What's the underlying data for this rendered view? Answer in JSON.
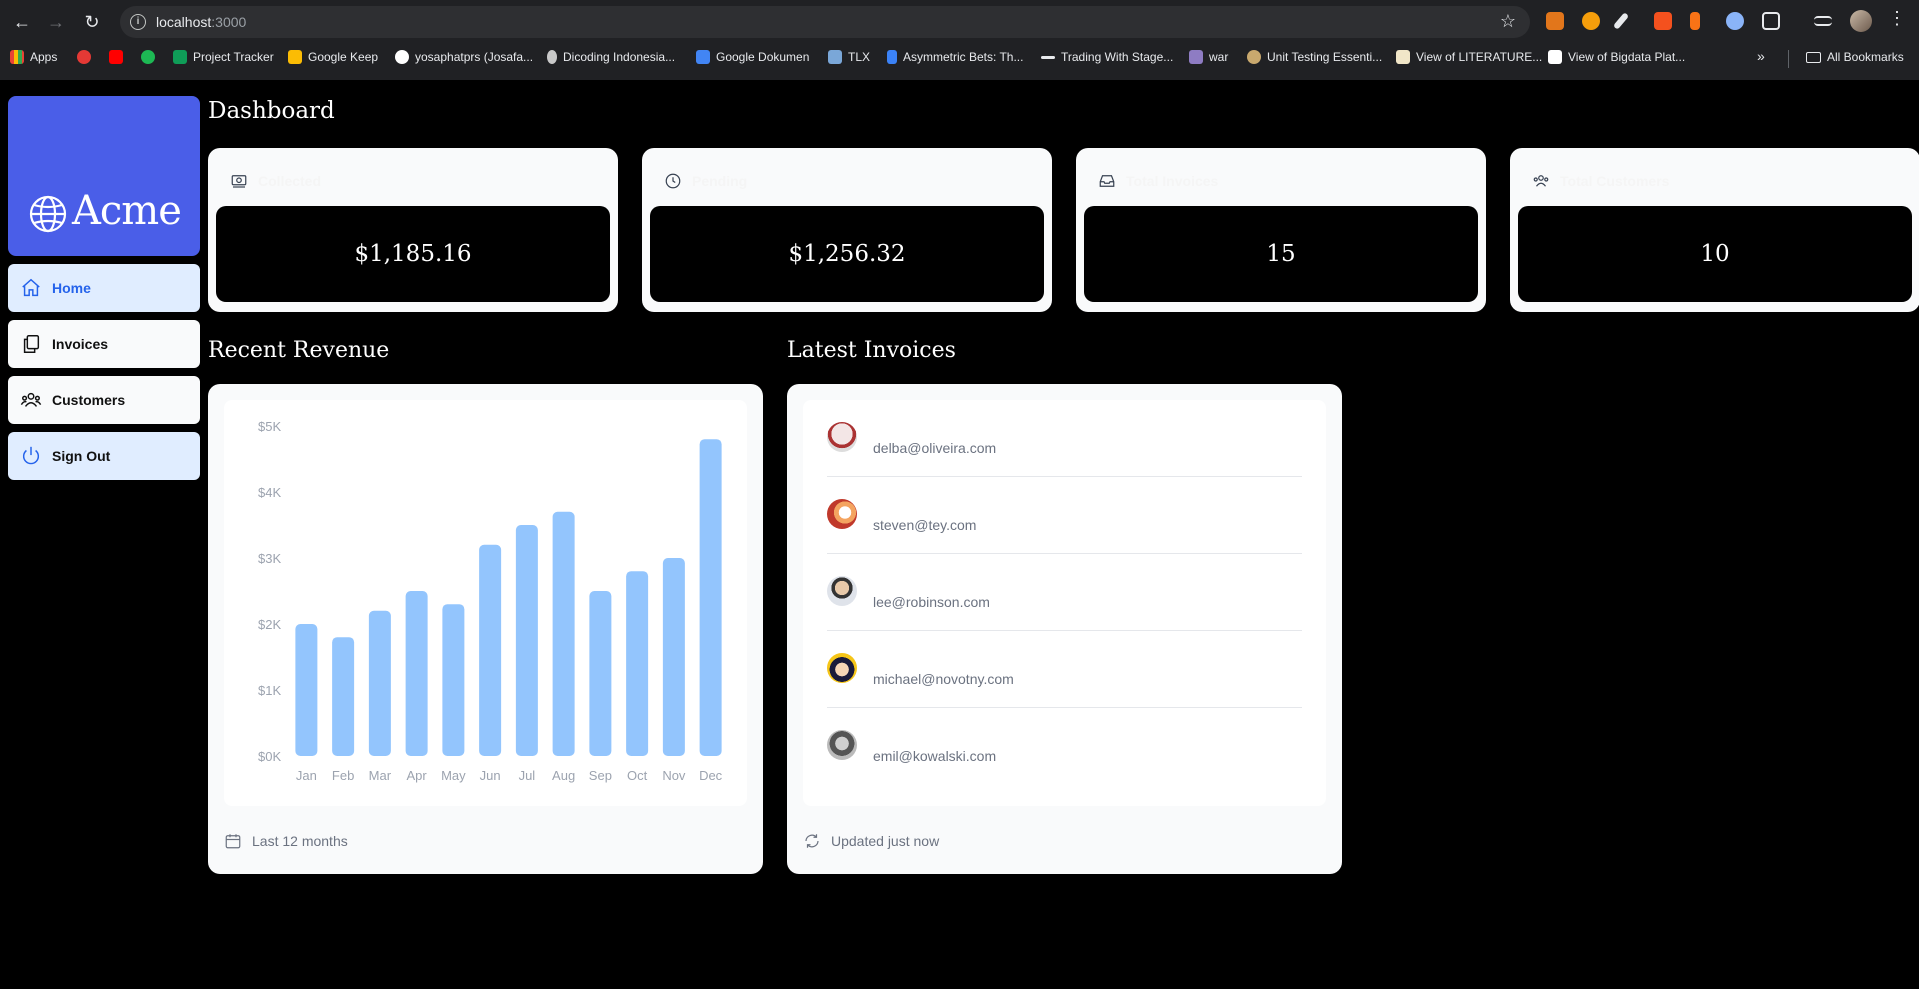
{
  "browser": {
    "url_host": "localhost",
    "url_port": ":3000",
    "bookmarks": [
      {
        "label": "Apps",
        "color": "#e8eaed"
      },
      {
        "label": "",
        "color": "#e53935"
      },
      {
        "label": "",
        "color": "#ff0000"
      },
      {
        "label": "",
        "color": "#1db954"
      },
      {
        "label": "Project Tracker",
        "color": "#0f9d58"
      },
      {
        "label": "Google Keep",
        "color": "#fbbc04"
      },
      {
        "label": "yosaphatprs (Josafa...",
        "color": "#ffffff"
      },
      {
        "label": "Dicoding Indonesia...",
        "color": "#c9c9c9"
      },
      {
        "label": "Google Dokumen",
        "color": "#4285f4"
      },
      {
        "label": "TLX",
        "color": "#7aa7d8"
      },
      {
        "label": "Asymmetric Bets: Th...",
        "color": "#3b82f6"
      },
      {
        "label": "Trading With Stage...",
        "color": "#e8eaed"
      },
      {
        "label": "war",
        "color": "#8e7cc3"
      },
      {
        "label": "Unit Testing Essenti...",
        "color": "#c9a96e"
      },
      {
        "label": "View of LITERATURE...",
        "color": "#f1e6c8"
      },
      {
        "label": "View of Bigdata Plat...",
        "color": "#ffffff"
      }
    ],
    "all_bookmarks": "All Bookmarks"
  },
  "sidebar": {
    "logo_text": "Acme",
    "items": [
      {
        "label": "Home",
        "icon": "home-icon"
      },
      {
        "label": "Invoices",
        "icon": "document-duplicate-icon"
      },
      {
        "label": "Customers",
        "icon": "user-group-icon"
      },
      {
        "label": "Sign Out",
        "icon": "power-icon"
      }
    ]
  },
  "dashboard": {
    "title": "Dashboard",
    "cards": [
      {
        "label": "Collected",
        "value": "$1,185.16",
        "icon": "banknotes-icon"
      },
      {
        "label": "Pending",
        "value": "$1,256.32",
        "icon": "clock-icon"
      },
      {
        "label": "Total Invoices",
        "value": "15",
        "icon": "inbox-icon"
      },
      {
        "label": "Total Customers",
        "value": "10",
        "icon": "user-group-icon"
      }
    ]
  },
  "revenue": {
    "title": "Recent Revenue",
    "footer": "Last 12 months"
  },
  "chart_data": {
    "type": "bar",
    "categories": [
      "Jan",
      "Feb",
      "Mar",
      "Apr",
      "May",
      "Jun",
      "Jul",
      "Aug",
      "Sep",
      "Oct",
      "Nov",
      "Dec"
    ],
    "values": [
      2000,
      1800,
      2200,
      2500,
      2300,
      3200,
      3500,
      3700,
      2500,
      2800,
      3000,
      4800
    ],
    "y_ticks": [
      "$0K",
      "$1K",
      "$2K",
      "$3K",
      "$4K",
      "$5K"
    ],
    "ylim": [
      0,
      5000
    ],
    "bar_color": "#93c5fd"
  },
  "invoices": {
    "title": "Latest Invoices",
    "footer": "Updated just now",
    "rows": [
      {
        "email": "delba@oliveira.com"
      },
      {
        "email": "steven@tey.com"
      },
      {
        "email": "lee@robinson.com"
      },
      {
        "email": "michael@novotny.com"
      },
      {
        "email": "emil@kowalski.com"
      }
    ]
  }
}
